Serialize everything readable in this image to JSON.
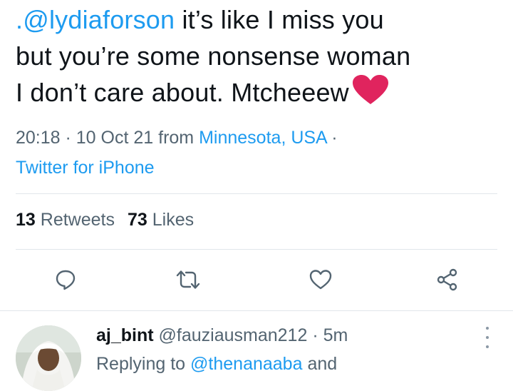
{
  "tweet": {
    "mention_prefix": ".",
    "mention": "@lydiaforson",
    "text_line1_rest": " it’s like I miss you",
    "text_line2": "but you’re some nonsense woman",
    "text_line3": "I don’t care about. Mtcheeew",
    "emoji": "red-heart"
  },
  "meta": {
    "time": "20:18",
    "sep1": " · ",
    "date": "10 Oct 21",
    "from": " from ",
    "location": "Minnesota, USA",
    "sep2": " ·",
    "source": "Twitter for iPhone"
  },
  "stats": {
    "retweets_count": "13",
    "retweets_label": "Retweets",
    "likes_count": "73",
    "likes_label": "Likes"
  },
  "actions": [
    "reply-icon",
    "retweet-icon",
    "like-icon",
    "share-icon"
  ],
  "reply": {
    "name": "aj_bint",
    "handle": "@fauziausman212",
    "sep": " · ",
    "time": "5m",
    "replying_prefix": "Replying to ",
    "replying_to": "@thenanaaba",
    "replying_suffix": " and"
  },
  "colors": {
    "accent": "#1d9bf0",
    "text": "#0f1419",
    "secondary": "#536471",
    "divider": "#e1e6ea",
    "heart": "#e0245e"
  }
}
